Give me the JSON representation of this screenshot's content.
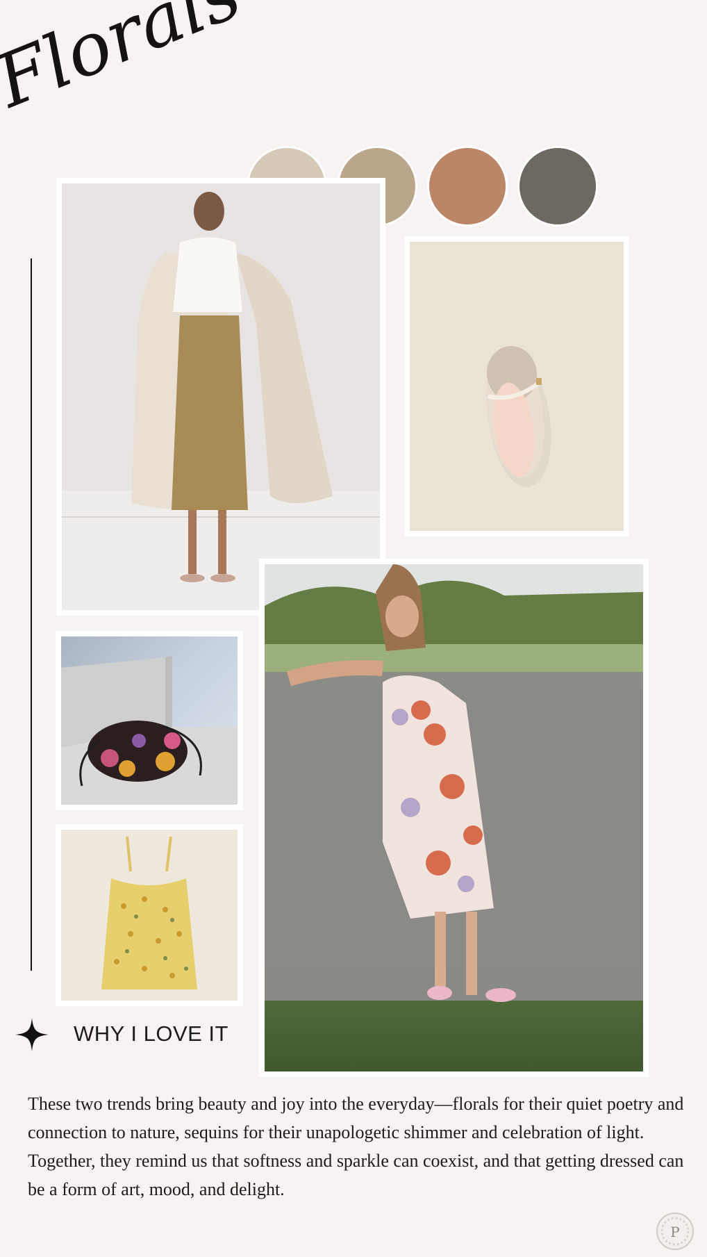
{
  "title": "Florals & Sequins",
  "palette": {
    "swatches": [
      "#d6c9b8",
      "#b9a68b",
      "#bc8568",
      "#6b6962"
    ]
  },
  "images": {
    "sequin_skirt": "model in beige coat with gold sequin midi skirt",
    "shoe": "tweed mary jane flat",
    "clutch": "floral sequin drawstring pouch",
    "cami": "yellow floral camisole",
    "dress": "floral midi dress against stone wall"
  },
  "section": {
    "heading": "WHY I LOVE IT"
  },
  "description": " These two trends bring beauty and joy into the everyday—florals for their quiet poetry and connection to nature, sequins for their unapologetic shimmer and celebration of light. Together, they remind us that softness and sparkle can coexist, and that getting dressed can be a form of art, mood, and delight.",
  "watermark": "P"
}
